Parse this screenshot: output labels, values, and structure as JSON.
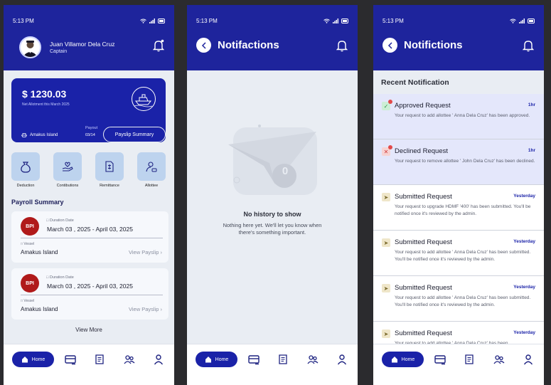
{
  "status_time": "5:13 PM",
  "nav": {
    "home": "Home"
  },
  "home": {
    "user_name": "Juan Villamor Dela Cruz",
    "user_role": "Captain",
    "balance": "$ 1230.03",
    "balance_sub": "Net Allotment this March 2025",
    "vessel": "Amakus Island",
    "payout_label": "Payout",
    "payout_value": "03/14",
    "payslip_button": "Payslip Summary",
    "actions": [
      "Deduction",
      "Contibutions",
      "Remittance",
      "Allottee"
    ],
    "section_title": "Payroll Summary",
    "cards": [
      {
        "logo": "BPI",
        "duration_label": "Duration Date",
        "duration": "March 03 , 2025 - April 03, 2025",
        "vessel_label": "Vessel",
        "vessel": "Amakus Island",
        "link": "View Payslip"
      },
      {
        "logo": "BPI",
        "duration_label": "Duration Date",
        "duration": "March 03 , 2025 - April 03, 2025",
        "vessel_label": "Vessel",
        "vessel": "Amakus Island",
        "link": "View Payslip"
      }
    ],
    "view_more": "View More"
  },
  "empty": {
    "title": "Notifactions",
    "badge": "0",
    "empty_title": "No history to show",
    "empty_body": "Nothing here yet. We'll let you know when there's something important."
  },
  "notifications": {
    "title": "Notifictions",
    "section": "Recent Notification",
    "items": [
      {
        "title": "Approved Request",
        "time": "1hr",
        "body": "Your request to add allottee ' Anna Dela Cruz' has been approved.",
        "icon": "check-icon",
        "color": "#2e9b4a"
      },
      {
        "title": "Declined Request",
        "time": "1hr",
        "body": "Your request to remove allottee ' John Dela Cruz' has been declined.",
        "icon": "x-icon",
        "color": "#d23a3a"
      },
      {
        "title": "Submitted Request",
        "time": "Yesterday",
        "body": "Your request to upgrade HDMF '400' has been submitted. You'll be notified once it's reviewed by the admin.",
        "icon": "send-icon",
        "color": "#a08a3c"
      },
      {
        "title": "Submitted Request",
        "time": "Yesterday",
        "body": "Your request to add allottee ' Anna Dela Cruz' has been submitted. You'll be notified once it's reviewed by the admin.",
        "icon": "send-icon",
        "color": "#a08a3c"
      },
      {
        "title": "Submitted Request",
        "time": "Yesterday",
        "body": "Your request to add allottee ' Anna Dela Cruz' has been submitted. You'll be notified once it's reviewed by the admin.",
        "icon": "send-icon",
        "color": "#a08a3c"
      },
      {
        "title": "Submitted Request",
        "time": "Yesterday",
        "body": "Your request to add allottee ' Anna Dela Cruz' has been",
        "icon": "send-icon",
        "color": "#a08a3c"
      }
    ]
  }
}
